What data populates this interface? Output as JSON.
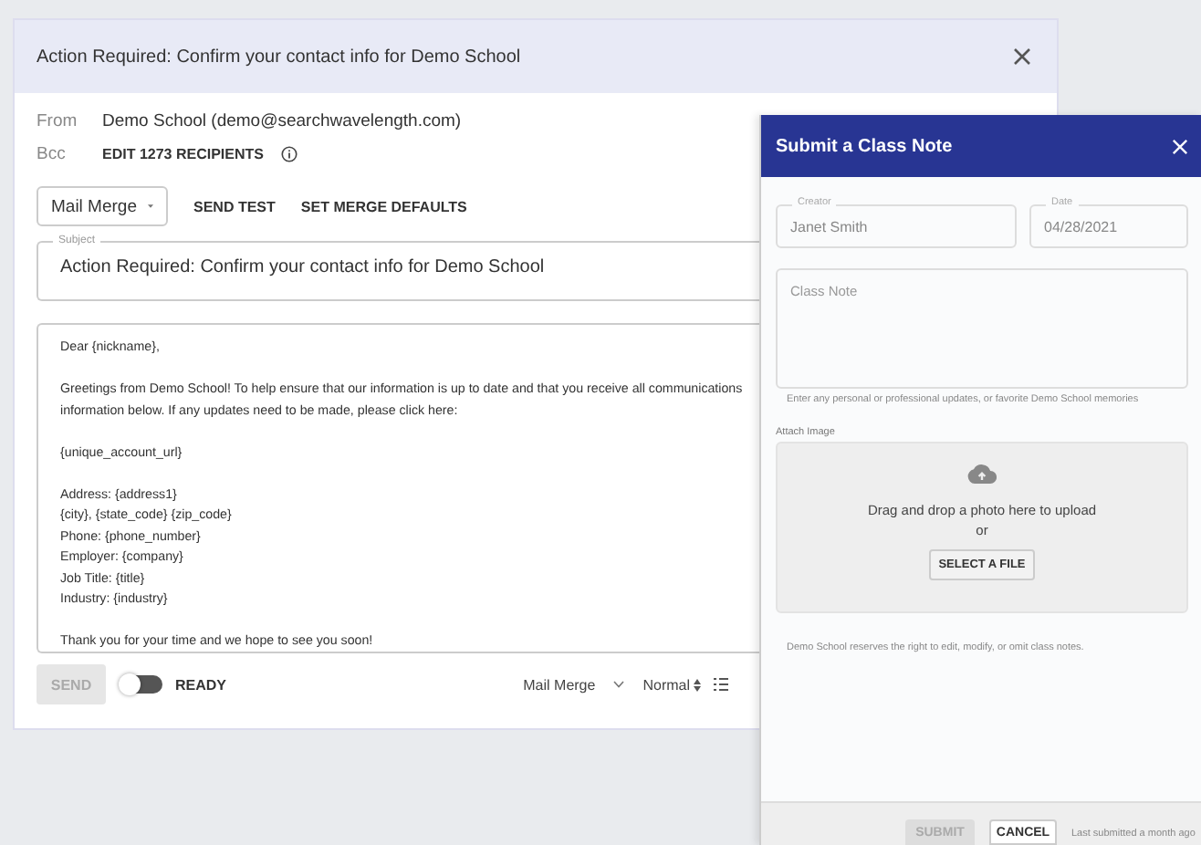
{
  "email": {
    "title": "Action Required: Confirm your contact info for Demo School",
    "from_label": "From",
    "from_value": "Demo School (demo@searchwavelength.com)",
    "bcc_label": "Bcc",
    "bcc_value": "EDIT 1273 RECIPIENTS",
    "merge_select": "Mail Merge",
    "actions": [
      "SEND TEST",
      "SET MERGE DEFAULTS"
    ],
    "subject": {
      "label": "Subject",
      "value": "Action Required: Confirm your contact info for Demo School"
    },
    "body": [
      [
        "Dear {nickname},"
      ],
      [
        "Greetings from Demo School! To help ensure that our information is up to date and that you receive all communications",
        "information below. If any updates need to be made, please click here:"
      ],
      [
        "{unique_account_url}"
      ],
      [
        "Address: {address1}",
        "{city}, {state_code} {zip_code}",
        "Phone: {phone_number}",
        "Employer: {company}",
        "Job Title: {title}",
        "Industry: {industry}"
      ],
      [
        "Thank you for your time and we hope to see you soon!"
      ]
    ],
    "send": {
      "label": "SEND",
      "disabled": true
    },
    "ready": {
      "label": "READY",
      "on": false
    },
    "toolbar": {
      "merge": "Mail Merge",
      "format": "Normal"
    }
  },
  "panel": {
    "title": "Submit a Class Note",
    "creator": {
      "label": "Creator",
      "value": "Janet Smith"
    },
    "date": {
      "label": "Date",
      "value": "04/28/2021"
    },
    "note": {
      "placeholder": "Class Note",
      "helper": "Enter any personal or professional updates, or favorite Demo School memories"
    },
    "attach_label": "Attach Image",
    "drop_text": "Drag and drop a photo here to upload",
    "or": "or",
    "select_button": "SELECT A FILE",
    "disclaimer": "Demo School reserves the right to edit, modify, or omit class notes.",
    "submit": {
      "label": "SUBMIT",
      "disabled": true
    },
    "cancel": "CANCEL",
    "last_submitted": "Last submitted a month ago"
  }
}
